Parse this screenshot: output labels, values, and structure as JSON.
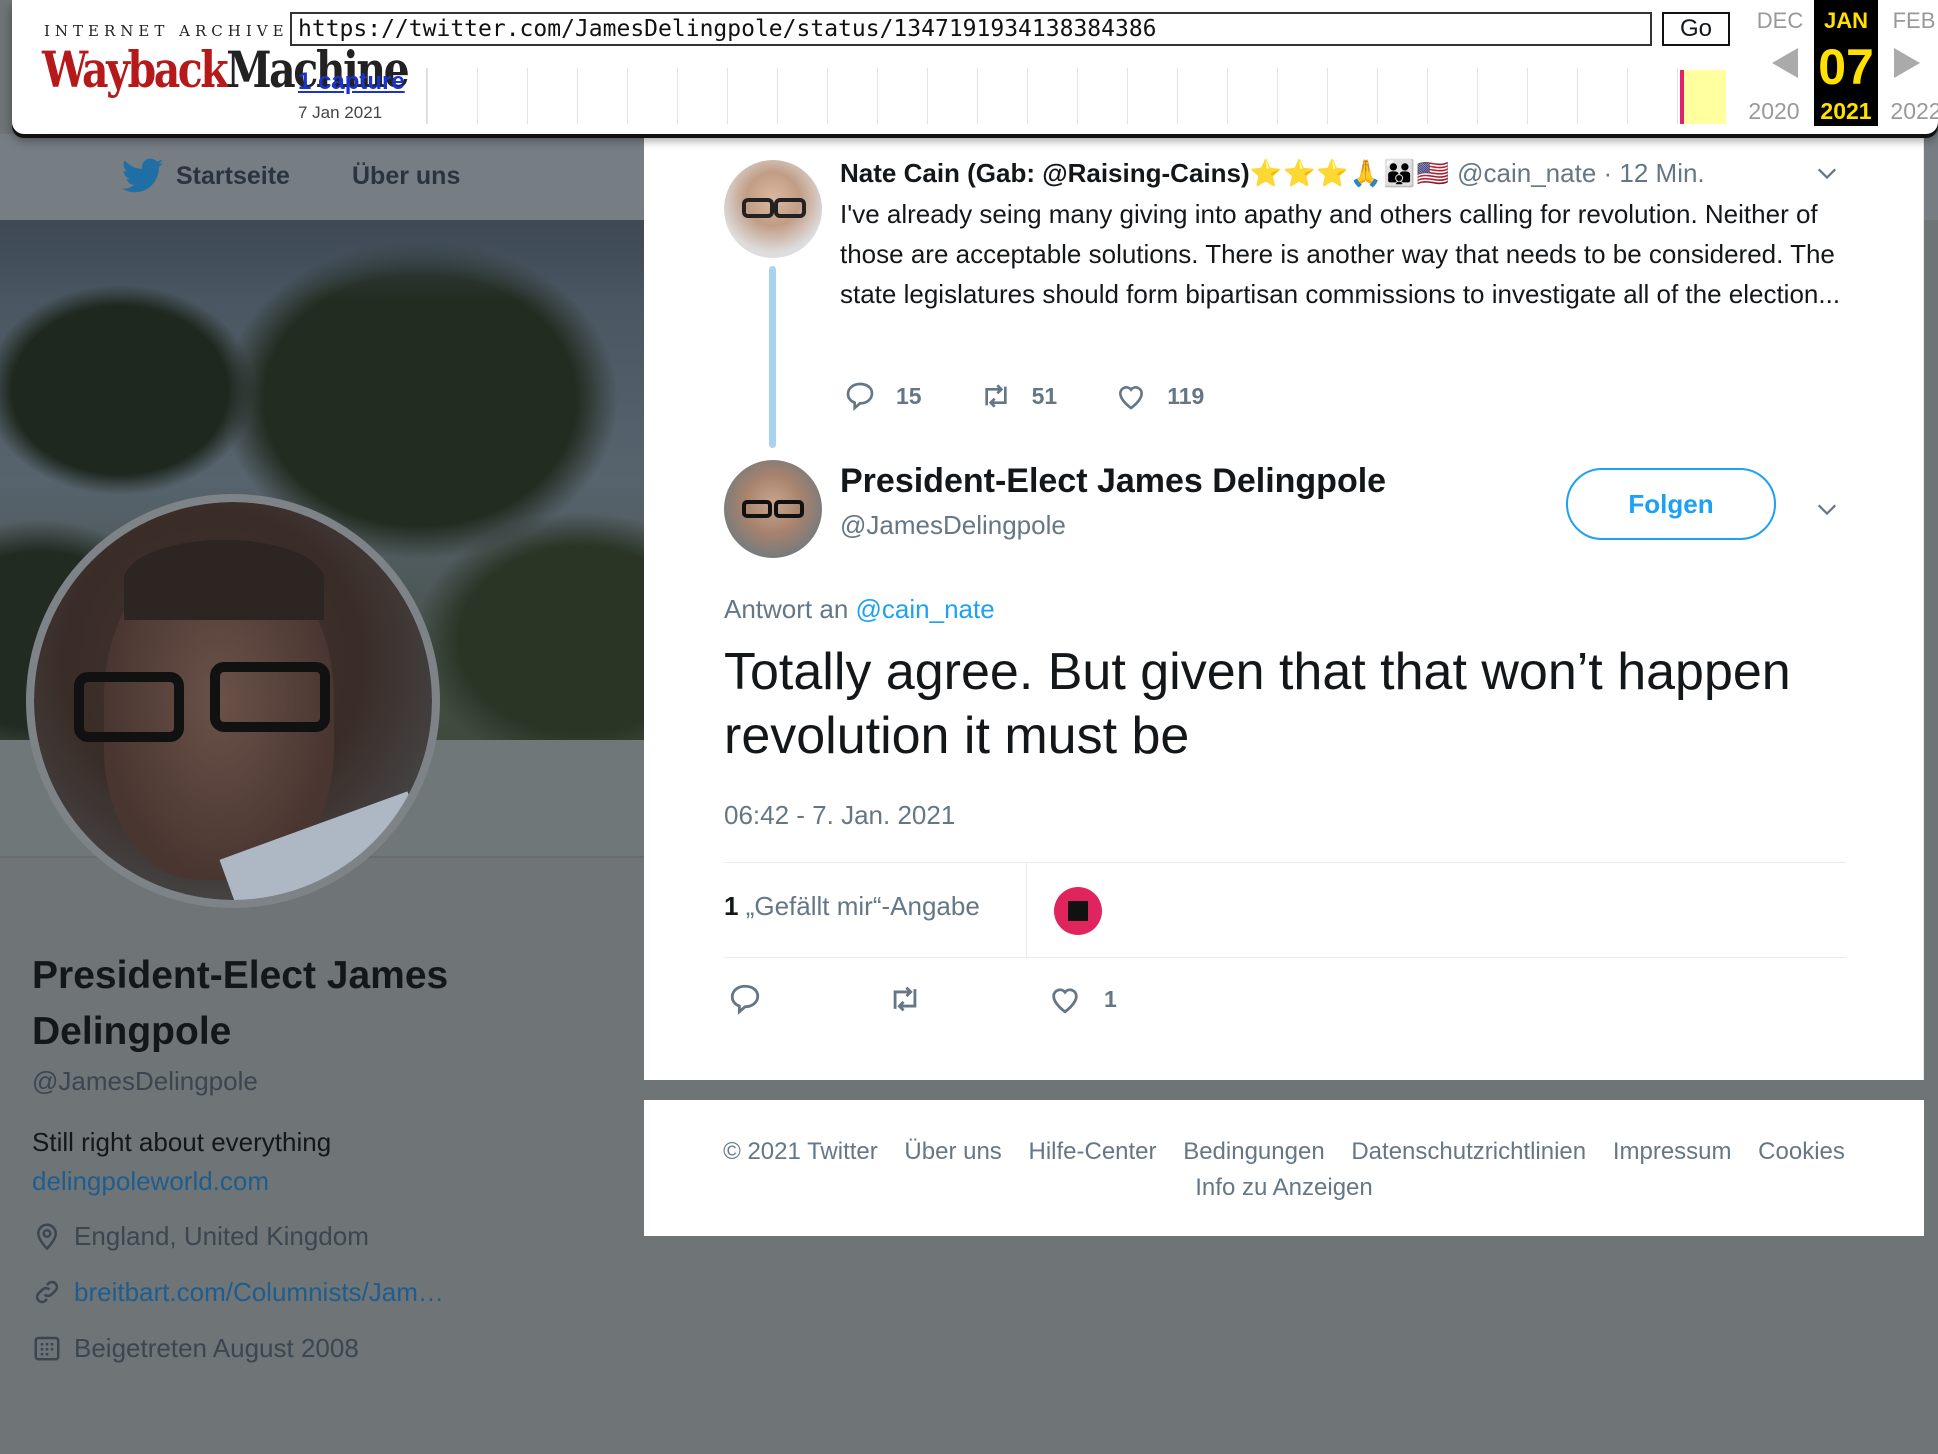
{
  "wayback": {
    "logo_top": "INTERNET ARCHIVE",
    "logo_way": "Wayback",
    "logo_machine": "Machine",
    "url": "https://twitter.com/JamesDelingpole/status/1347191934138384386",
    "go": "Go",
    "captures": "1 capture",
    "capture_date": "7 Jan 2021",
    "prev_month": "DEC",
    "cur_month": "JAN",
    "next_month": "FEB",
    "cur_day": "07",
    "prev_year": "2020",
    "cur_year": "2021",
    "next_year": "2022"
  },
  "nav": {
    "home": "Startseite",
    "about": "Über uns"
  },
  "profile": {
    "name": "President-Elect James Delingpole",
    "handle": "@JamesDelingpole",
    "bio": "Still right about everything",
    "website": "delingpoleworld.com",
    "location": "England, United Kingdom",
    "link": "breitbart.com/Columnists/Jam…",
    "joined": "Beigetreten August 2008"
  },
  "context_tweet": {
    "name": "Nate Cain (Gab: @Raising-Cains)",
    "emojis": "⭐⭐⭐🙏👪🇺🇸",
    "handle": "@cain_nate",
    "time": "· 12 Min.",
    "text": "I've already seing many giving into apathy and others calling for revolution. Neither of those are acceptable solutions. There is another way that needs to be considered. The state legislatures should form bipartisan commissions to investigate all of the election...",
    "replies": "15",
    "retweets": "51",
    "likes": "119"
  },
  "main_tweet": {
    "name": "President-Elect James Delingpole",
    "handle": "@JamesDelingpole",
    "follow": "Folgen",
    "reply_prefix": "Antwort an",
    "reply_handle": "@cain_nate",
    "text": "Totally agree. But given that that won’t happen revolution it must be",
    "timestamp": "06:42 - 7. Jan. 2021",
    "like_count": "1",
    "like_label": "„Gefällt mir“-Angabe",
    "action_like_count": "1"
  },
  "footer": {
    "copyright": "© 2021 Twitter",
    "about": "Über uns",
    "help": "Hilfe-Center",
    "terms": "Bedingungen",
    "privacy": "Datenschutzrichtlinien",
    "imprint": "Impressum",
    "cookies": "Cookies",
    "ads": "Info zu Anzeigen"
  },
  "colors": {
    "twitter_blue": "#1da1f2",
    "wayback_red": "#b5191a",
    "calendar_yellow": "#ffe000",
    "like_red": "#e0245e"
  },
  "icons": [
    "twitter-bird-icon",
    "location-icon",
    "link-icon",
    "calendar-icon",
    "reply-icon",
    "retweet-icon",
    "heart-icon",
    "chevron-down-icon"
  ]
}
